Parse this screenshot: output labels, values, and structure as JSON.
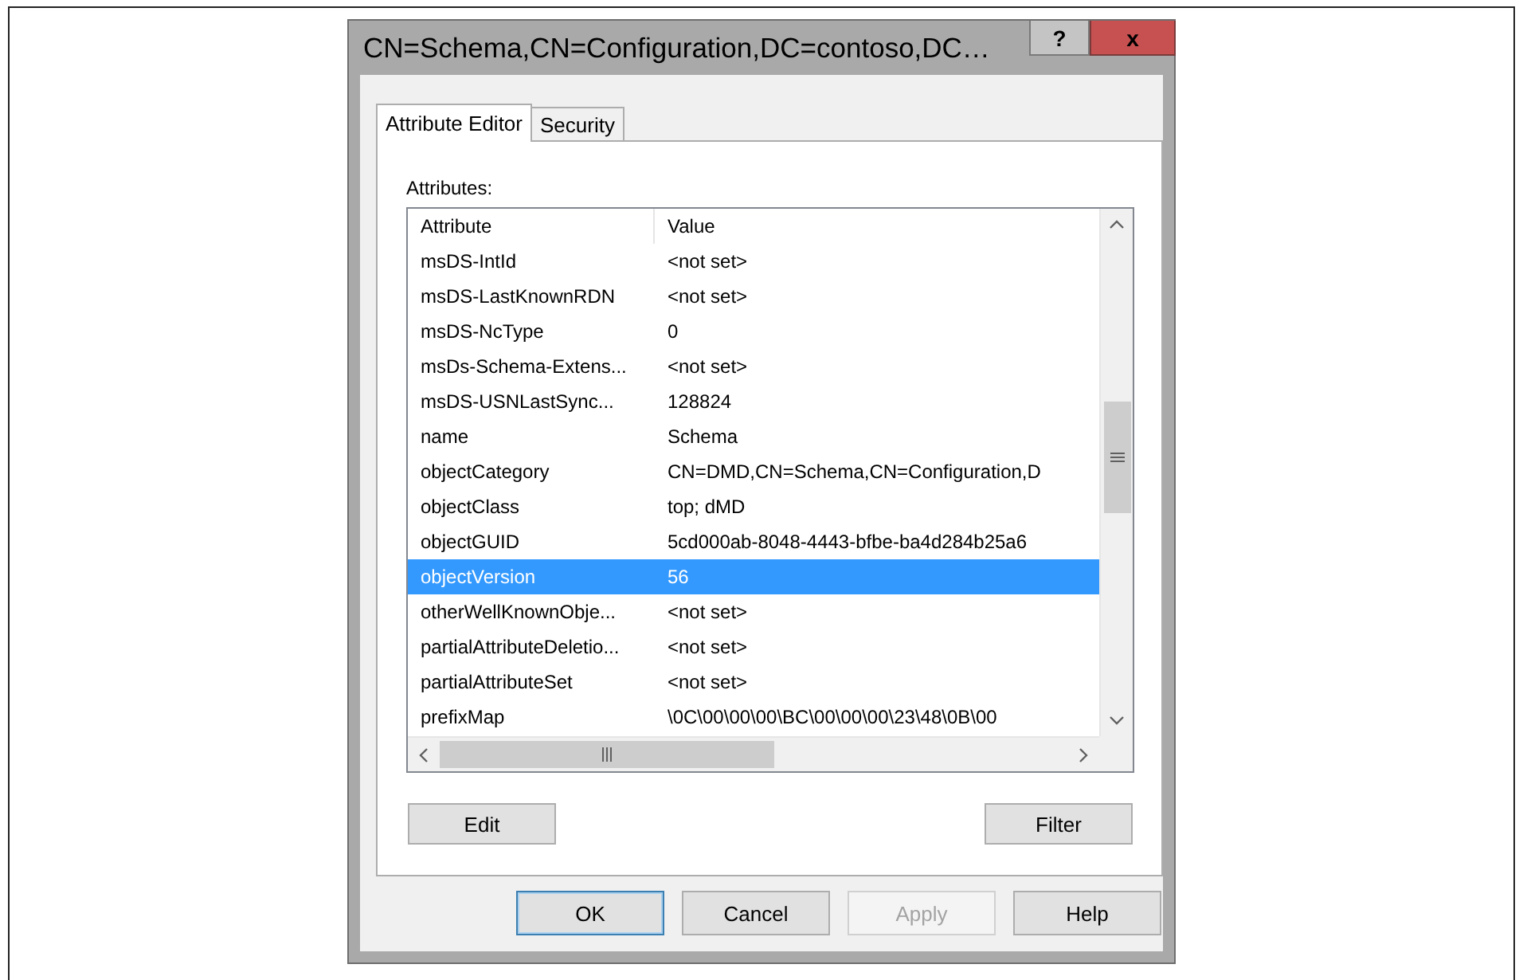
{
  "window": {
    "title": "CN=Schema,CN=Configuration,DC=contoso,DC…",
    "help_button": "?",
    "close_button": "x"
  },
  "tabs": [
    {
      "label": "Attribute Editor",
      "selected": true
    },
    {
      "label": "Security",
      "selected": false
    }
  ],
  "attributes_label": "Attributes:",
  "table": {
    "columns": [
      "Attribute",
      "Value"
    ],
    "rows": [
      {
        "attribute": "msDS-IntId",
        "value": "<not set>",
        "selected": false
      },
      {
        "attribute": "msDS-LastKnownRDN",
        "value": "<not set>",
        "selected": false
      },
      {
        "attribute": "msDS-NcType",
        "value": "0",
        "selected": false
      },
      {
        "attribute": "msDs-Schema-Extens...",
        "value": "<not set>",
        "selected": false
      },
      {
        "attribute": "msDS-USNLastSync...",
        "value": "128824",
        "selected": false
      },
      {
        "attribute": "name",
        "value": "Schema",
        "selected": false
      },
      {
        "attribute": "objectCategory",
        "value": "CN=DMD,CN=Schema,CN=Configuration,D",
        "selected": false
      },
      {
        "attribute": "objectClass",
        "value": "top; dMD",
        "selected": false
      },
      {
        "attribute": "objectGUID",
        "value": "5cd000ab-8048-4443-bfbe-ba4d284b25a6",
        "selected": false
      },
      {
        "attribute": "objectVersion",
        "value": "56",
        "selected": true
      },
      {
        "attribute": "otherWellKnownObje...",
        "value": "<not set>",
        "selected": false
      },
      {
        "attribute": "partialAttributeDeletio...",
        "value": "<not set>",
        "selected": false
      },
      {
        "attribute": "partialAttributeSet",
        "value": "<not set>",
        "selected": false
      },
      {
        "attribute": "prefixMap",
        "value": "\\0C\\00\\00\\00\\BC\\00\\00\\00\\23\\48\\0B\\00",
        "selected": false
      }
    ]
  },
  "panel_buttons": [
    {
      "label": "Edit",
      "disabled": false
    },
    {
      "label": "Filter",
      "disabled": false
    }
  ],
  "dialog_buttons": [
    {
      "label": "OK",
      "default": true,
      "disabled": false
    },
    {
      "label": "Cancel",
      "default": false,
      "disabled": false
    },
    {
      "label": "Apply",
      "default": false,
      "disabled": true
    },
    {
      "label": "Help",
      "default": false,
      "disabled": false
    }
  ]
}
